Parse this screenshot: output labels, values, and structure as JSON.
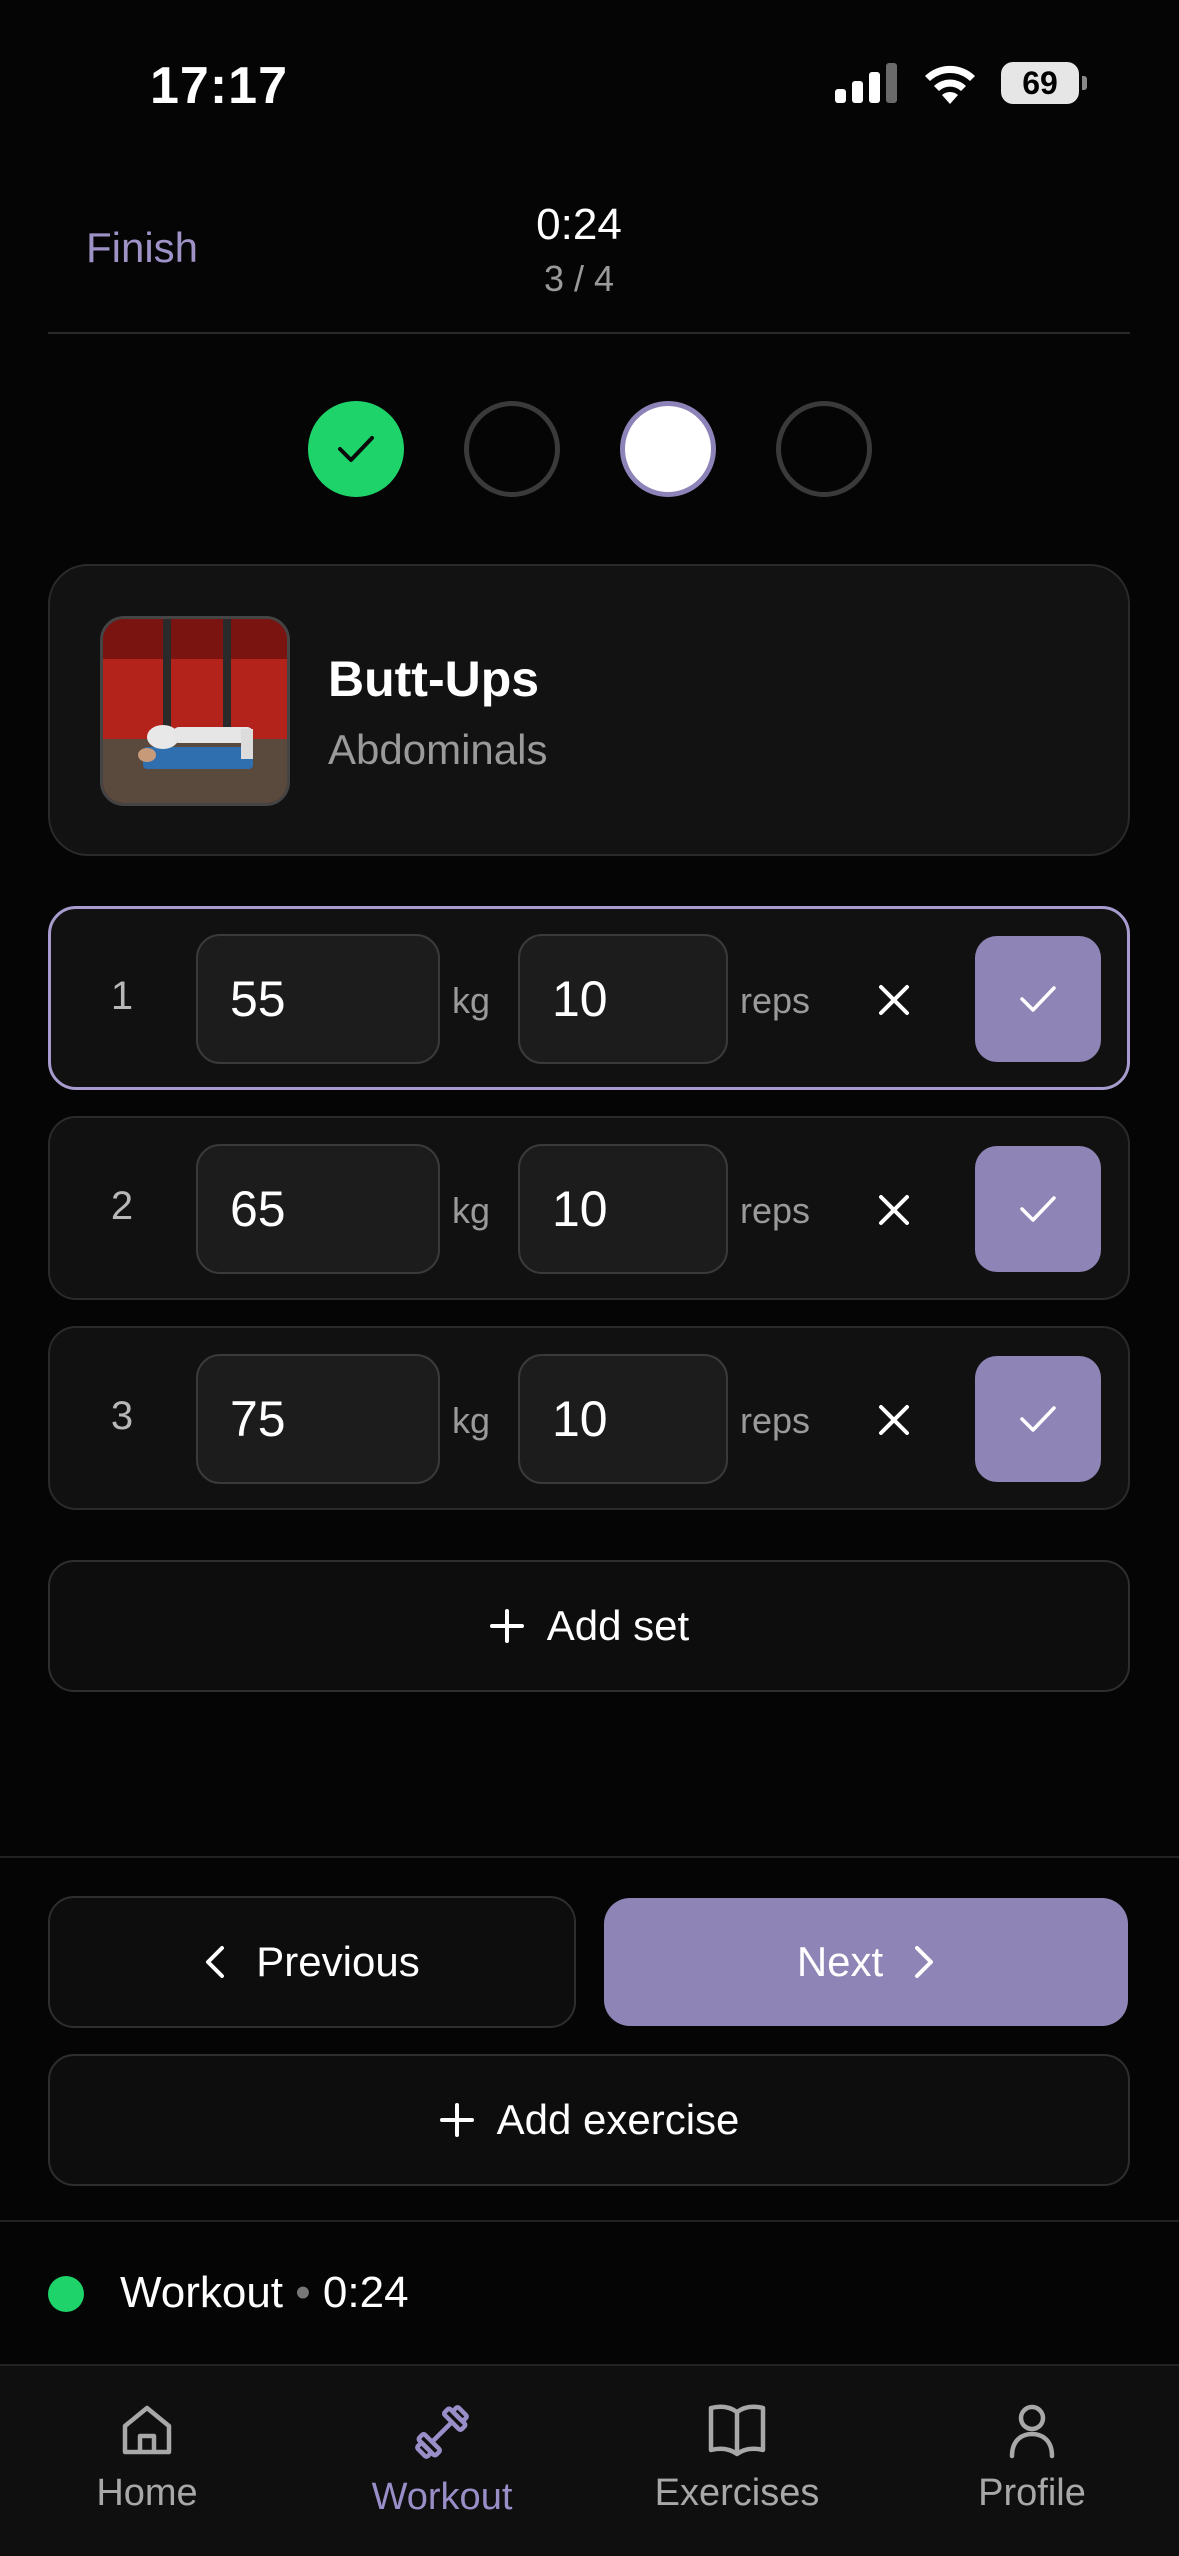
{
  "status_bar": {
    "time": "17:17",
    "battery": "69"
  },
  "header": {
    "finish_label": "Finish",
    "timer": "0:24",
    "progress": "3 / 4"
  },
  "exercise": {
    "name": "Butt-Ups",
    "muscle": "Abdominals"
  },
  "sets": [
    {
      "number": "1",
      "weight": "55",
      "weight_unit": "kg",
      "reps": "10",
      "reps_unit": "reps"
    },
    {
      "number": "2",
      "weight": "65",
      "weight_unit": "kg",
      "reps": "10",
      "reps_unit": "reps"
    },
    {
      "number": "3",
      "weight": "75",
      "weight_unit": "kg",
      "reps": "10",
      "reps_unit": "reps"
    }
  ],
  "actions": {
    "add_set": "Add set",
    "previous": "Previous",
    "next": "Next",
    "add_exercise": "Add exercise"
  },
  "live_workout": {
    "label": "Workout",
    "separator": "•",
    "time": "0:24"
  },
  "tabs": [
    {
      "label": "Home"
    },
    {
      "label": "Workout"
    },
    {
      "label": "Exercises"
    },
    {
      "label": "Profile"
    }
  ],
  "colors": {
    "accent": "#8e84b5",
    "success": "#1ed46a",
    "background": "#050505"
  }
}
